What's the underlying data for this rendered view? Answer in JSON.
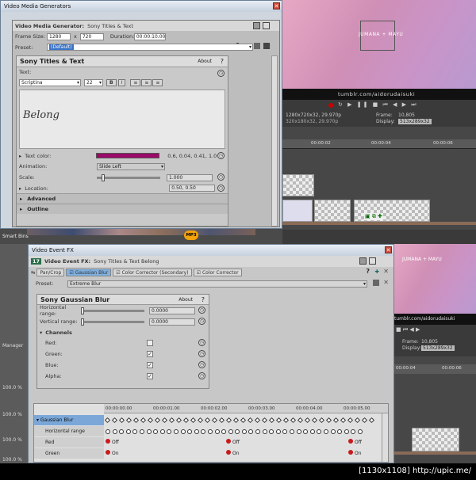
{
  "vmg": {
    "window_title": "Video Media Generators",
    "header_label": "Video Media Generator:",
    "header_value": "Sony Titles & Text",
    "frame_size_label": "Frame Size:",
    "width": "1280",
    "x_sep": "x",
    "height": "720",
    "duration_label": "Duration:",
    "duration": "00:00:10.00",
    "preset_label": "Preset:",
    "preset_value": "(Default)",
    "panel_title": "Sony Titles & Text",
    "about": "About",
    "help": "?",
    "text_label": "Text:",
    "font": "Scriptina",
    "font_size": "22",
    "bold": "B",
    "italic": "I",
    "preview_text": "Belong",
    "text_color_label": "Text color:",
    "text_color_value": "0.6, 0.04, 0.41, 1.0",
    "animation_label": "Animation:",
    "animation_value": "Slide Left",
    "scale_label": "Scale:",
    "scale_value": "1.000",
    "location_label": "Location:",
    "location_value": "0.50, 0.50",
    "advanced": "Advanced",
    "outline": "Outline"
  },
  "preview": {
    "overlay_text": "JUMANA + MAYU",
    "watermark": "tumblr.com/aidorudaisuki",
    "project_info_1": "1280x720x32, 29.970p",
    "project_info_2": "320x180x32, 29.970p",
    "frame_label": "Frame:",
    "frame_value": "10,805",
    "display_label": "Display:",
    "display_value": "513x289x32"
  },
  "timeline_top": {
    "ticks": [
      "00:00:02",
      "00:00:04",
      "00:00:06"
    ],
    "smart_bins": "Smart Bins",
    "mp3_label": "MP3"
  },
  "lower_preview": {
    "overlay_text": "JUMANA + MAYU",
    "watermark": "tumblr.com/aidorudaisuki",
    "frame_label": "Frame:",
    "frame_value": "10,805",
    "display_label": "Display:",
    "display_value": "513x289x32",
    "ticks": [
      "00:00:04",
      "00:00:06"
    ]
  },
  "left_panel": {
    "manager": "Manager",
    "pct": [
      "100.0 %",
      "100.0 %",
      "100.0 %",
      "100.0 %"
    ]
  },
  "vef": {
    "window_title": "Video Event FX",
    "badge": "17",
    "header_label": "Video Event FX:",
    "header_value": "Sony Titles & Text Belong",
    "chain": [
      "Pan/Crop",
      "Gaussian Blur",
      "Color Corrector (Secondary)",
      "Color Corrector"
    ],
    "preset_label": "Preset:",
    "preset_value": "Extreme Blur",
    "panel_title": "Sony Gaussian Blur",
    "about": "About",
    "help": "?",
    "h_range_label": "Horizontal range:",
    "h_range_value": "0.0000",
    "v_range_label": "Vertical range:",
    "v_range_value": "0.0000",
    "channels": "Channels",
    "red": "Red:",
    "green": "Green:",
    "blue": "Blue:",
    "alpha": "Alpha:",
    "timeline_ticks": [
      "00:00:00.00",
      "00:00:01.00",
      "00:00:02.00",
      "00:00:03.00",
      "00:00:04.00",
      "00:00:05.00"
    ],
    "track_header": "Gaussian Blur",
    "track_rows": [
      "Horizontal range",
      "Red",
      "Green"
    ],
    "off": "Off",
    "on": "On"
  },
  "footer": {
    "text": "[1130x1108] http://upic.me/"
  }
}
